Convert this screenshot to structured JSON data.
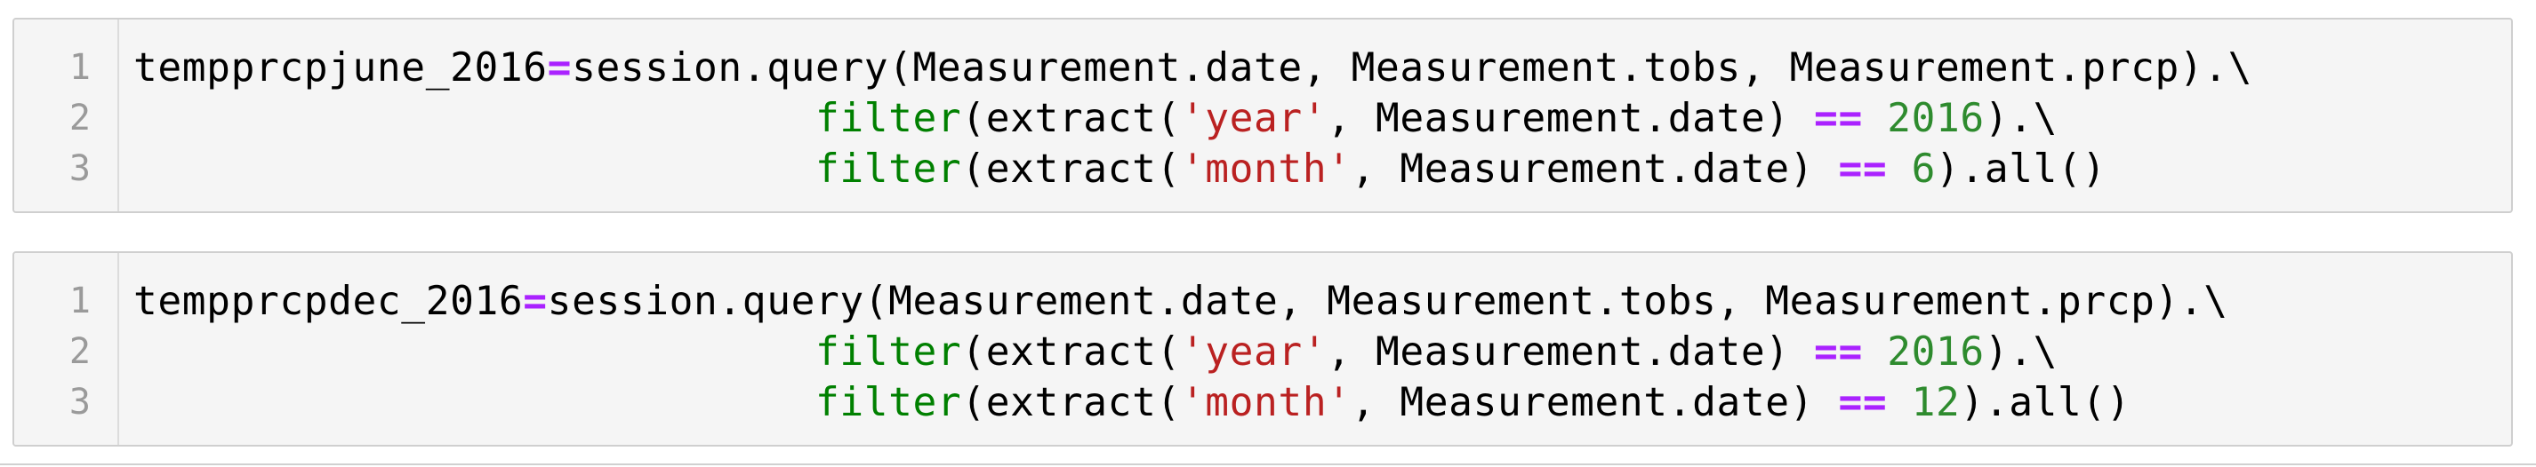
{
  "cells": [
    {
      "line_numbers": [
        "1",
        "2",
        "3"
      ],
      "lines": [
        {
          "var": "tempprcpjune_2016",
          "op": "=",
          "rest": "session.query(Measurement.date, Measurement.tobs, Measurement.prcp).\\"
        },
        {
          "indent": "                            ",
          "func": "filter",
          "pre": "(extract(",
          "str": "'year'",
          "mid": ", Measurement.date) ",
          "op": "==",
          "sp": " ",
          "num": "2016",
          "end": ").\\"
        },
        {
          "indent": "                            ",
          "func": "filter",
          "pre": "(extract(",
          "str": "'month'",
          "mid": ", Measurement.date) ",
          "op": "==",
          "sp": " ",
          "num": "6",
          "end": ").all()"
        }
      ]
    },
    {
      "line_numbers": [
        "1",
        "2",
        "3"
      ],
      "lines": [
        {
          "var": "tempprcpdec_2016",
          "op": "=",
          "rest": "session.query(Measurement.date, Measurement.tobs, Measurement.prcp).\\"
        },
        {
          "indent": "                            ",
          "func": "filter",
          "pre": "(extract(",
          "str": "'year'",
          "mid": ", Measurement.date) ",
          "op": "==",
          "sp": " ",
          "num": "2016",
          "end": ").\\"
        },
        {
          "indent": "                            ",
          "func": "filter",
          "pre": "(extract(",
          "str": "'month'",
          "mid": ", Measurement.date) ",
          "op": "==",
          "sp": " ",
          "num": "12",
          "end": ").all()"
        }
      ]
    }
  ],
  "colors": {
    "operator": "#aa22ff",
    "builtin": "#008000",
    "string": "#ba2121",
    "number": "#2e8b2e",
    "cell_background": "#f5f5f5",
    "cell_border": "#cfcfcf",
    "line_number": "#9a9a9a"
  }
}
